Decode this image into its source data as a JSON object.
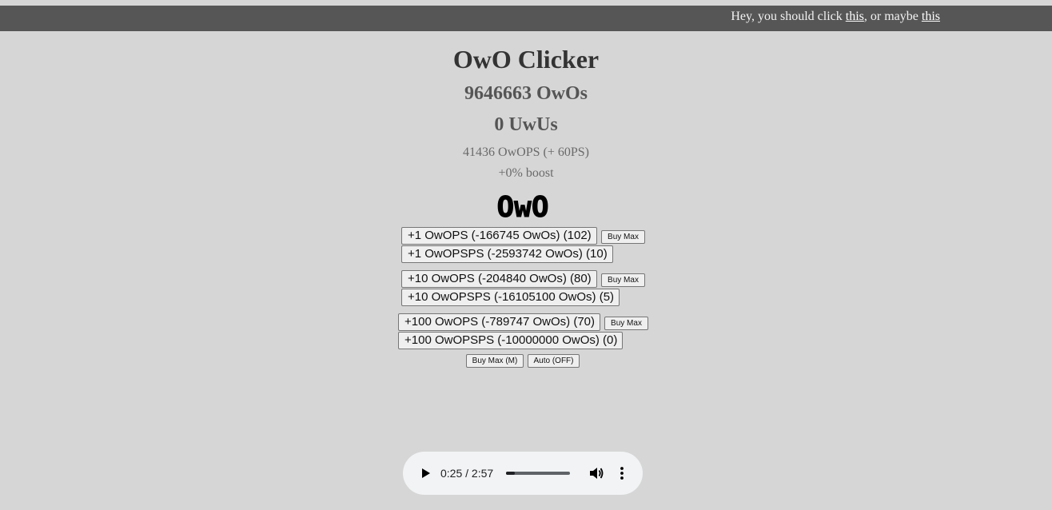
{
  "banner": {
    "prefix": "Hey, you should click ",
    "link1": "this",
    "middle": ", or maybe ",
    "link2": "this"
  },
  "game": {
    "title": "OwO Clicker",
    "owos": "9646663 OwOs",
    "uwus": "0 UwUs",
    "rate": "41436 OwOPS (+ 60PS)",
    "boost": "+0% boost",
    "logo": "OwO"
  },
  "upgrades": [
    {
      "ops_label": "+1 OwOPS (-166745 OwOs) (102)",
      "buy_max_label": "Buy Max",
      "opsps_label": "+1 OwOPSPS (-2593742 OwOs) (10)"
    },
    {
      "ops_label": "+10 OwOPS (-204840 OwOs) (80)",
      "buy_max_label": "Buy Max",
      "opsps_label": "+10 OwOPSPS (-16105100 OwOs) (5)"
    },
    {
      "ops_label": "+100 OwOPS (-789747 OwOs) (70)",
      "buy_max_label": "Buy Max",
      "opsps_label": "+100 OwOPSPS (-10000000 OwOs) (0)"
    }
  ],
  "controls": {
    "buy_max_all": "Buy Max (M)",
    "auto": "Auto (OFF)"
  },
  "audio": {
    "time": "0:25 / 2:57",
    "progress": 0.141
  },
  "icons": {
    "play": "play-icon",
    "volume": "volume-icon",
    "more": "more-vert-icon"
  }
}
